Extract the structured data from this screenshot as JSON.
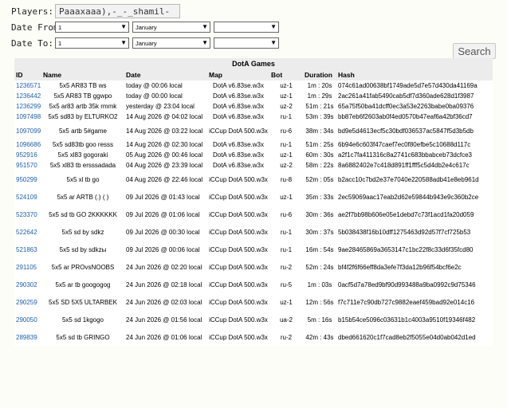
{
  "filters": {
    "players_label": "Players:",
    "players_value": "Paaaxaaa),-_-_shamil-_-_",
    "date_from_label": "Date From:",
    "date_to_label": "Date To:",
    "from_day": "1",
    "from_month": "January",
    "from_year": "",
    "to_day": "1",
    "to_month": "January",
    "to_year": ""
  },
  "search_label": "Search",
  "table": {
    "title": "DotA Games",
    "headers": [
      "ID",
      "Name",
      "Date",
      "Map",
      "Bot",
      "Duration",
      "Hash"
    ],
    "rows": [
      {
        "id": "1236571",
        "name": "5x5 AR83 TB ws",
        "date": "today @ 00:06 local",
        "map": "DotA v6.83se.w3x",
        "bot": "uz-1",
        "dur": "1m : 20s",
        "hash": "074c61ad00638bf1749ade5d7e57d430da41169a"
      },
      {
        "id": "1236442",
        "name": "5x5 AR83 TB ggwpo",
        "date": "today @ 00:00 local",
        "map": "DotA v6.83se.w3x",
        "bot": "uz-1",
        "dur": "1m : 29s",
        "hash": "2ac261a41fab5490cab5df7d360ade628d1f3987"
      },
      {
        "id": "1236299",
        "name": "5x5 ar83 artb 35k rmmk",
        "date": "yesterday @ 23:04 local",
        "map": "DotA v6.83se.w3x",
        "bot": "uz-2",
        "dur": "51m : 21s",
        "hash": "65a75f50ba41dcff0ec3a53e2263babe0ba09376"
      },
      {
        "id": "1097498",
        "name": "5x5 sd83 by ELTURKO2",
        "date": "14 Aug 2026 @ 04:02 local",
        "map": "DotA v6.83se.w3x",
        "bot": "ru-1",
        "dur": "53m : 39s",
        "hash": "bb87eb6f2603ab0f4ed0570b47eaf6a42bf36cd7"
      },
      {
        "id": "1097099",
        "name": "5x5 artb 5#game",
        "date": "14 Aug 2026 @ 03:22 local",
        "map": "iCCup DotA 500.w3x",
        "bot": "ru-6",
        "dur": "38m : 34s",
        "hash": "bd9e5d4613ecf5c30bdf036537ac5847f5d3b5db"
      },
      {
        "id": "1096686",
        "name": "5x5 sd83tb goo resss",
        "date": "14 Aug 2026 @ 02:30 local",
        "map": "DotA v6.83se.w3x",
        "bot": "ru-1",
        "dur": "51m : 25s",
        "hash": "6b94e6c603f47caef7ec0f80efbe5c10688d117c"
      },
      {
        "id": "952916",
        "name": "5x5 xl83 gogoraki",
        "date": "05 Aug 2026 @ 00:46 local",
        "map": "DotA v6.83se.w3x",
        "bot": "uz-1",
        "dur": "60m : 30s",
        "hash": "a2f1c7fa411316c8a2741c683bbabceb73dcfce3"
      },
      {
        "id": "951570",
        "name": "5x5 xl83 tb ersssadada",
        "date": "04 Aug 2026 @ 23:39 local",
        "map": "DotA v6.83se.w3x",
        "bot": "uz-2",
        "dur": "58m : 22s",
        "hash": "8a6882402e7c418d891ff1fff5c5d4db2e4c617c"
      },
      {
        "id": "950299",
        "name": "5x5 xl tb go",
        "date": "04 Aug 2026 @ 22:46 local",
        "map": "iCCup DotA 500.w3x",
        "bot": "ru-8",
        "dur": "52m : 05s",
        "hash": "b2acc10c7bd2e37e7040e220588adb41e8eb961d"
      },
      {
        "id": "524109",
        "name": "5x5 ar ARTB (.) ( )",
        "date": "09 Jul 2026 @ 01:43 local",
        "map": "iCCup DotA 500.w3x",
        "bot": "uz-1",
        "dur": "35m : 33s",
        "hash": "2ec59069aac17eab2d62e59844b943e9c360b2ce"
      },
      {
        "id": "523370",
        "name": "5x5 sd tb GO 2KKKKKK",
        "date": "09 Jul 2026 @ 01:06 local",
        "map": "iCCup DotA 500.w3x",
        "bot": "ru-6",
        "dur": "30m : 36s",
        "hash": "ae2f7bb98b606e05e1debd7c73f1acd1fa20d059"
      },
      {
        "id": "522642",
        "name": "5x5 sd by sdkz",
        "date": "09 Jul 2026 @ 00:30 local",
        "map": "iCCup DotA 500.w3x",
        "bot": "ru-1",
        "dur": "30m : 37s",
        "hash": "5b038438f16b10dff1275463d92d57f7cf725b53"
      },
      {
        "id": "521863",
        "name": "5x5 sd by sdkzы",
        "date": "09 Jul 2026 @ 00:06 local",
        "map": "iCCup DotA 500.w3x",
        "bot": "ru-1",
        "dur": "16m : 54s",
        "hash": "9ae28465869a3653147c1bc22f8c33d6f35fcd80"
      },
      {
        "id": "291105",
        "name": "5x5 ar PROvsNOOBS",
        "date": "24 Jun 2026 @ 02:20 local",
        "map": "iCCup DotA 500.w3x",
        "bot": "ru-2",
        "dur": "52m : 24s",
        "hash": "bf4f2f6f66eff8da3efe7f3da12b96f54bcf6e2c"
      },
      {
        "id": "290302",
        "name": "5x5 ar tb googogog",
        "date": "24 Jun 2026 @ 02:18 local",
        "map": "iCCup DotA 500.w3x",
        "bot": "ru-5",
        "dur": "1m : 03s",
        "hash": "0acf5d7a78ed9bf90d993488a9ba0992c9d75346"
      },
      {
        "id": "290259",
        "name": "5x5 SD 5X5 ULTARBEK",
        "date": "24 Jun 2026 @ 02:03 local",
        "map": "iCCup DotA 500.w3x",
        "bot": "uz-1",
        "dur": "12m : 56s",
        "hash": "f7c711e7c90db727c9882eaef459bad92e014c16"
      },
      {
        "id": "290050",
        "name": "5x5 sd 1kgogo",
        "date": "24 Jun 2026 @ 01:56 local",
        "map": "iCCup DotA 500.w3x",
        "bot": "ua-2",
        "dur": "5m : 16s",
        "hash": "b15b54ce5096c03631b1c4003a9510f19346f482"
      },
      {
        "id": "289839",
        "name": "5x5 sd tb GRINGO",
        "date": "24 Jun 2026 @ 01:06 local",
        "map": "iCCup DotA 500.w3x",
        "bot": "ru-2",
        "dur": "42m : 43s",
        "hash": "dbed661620c1f7cad8eb2f5055e04d0ab042d1ed"
      }
    ]
  }
}
